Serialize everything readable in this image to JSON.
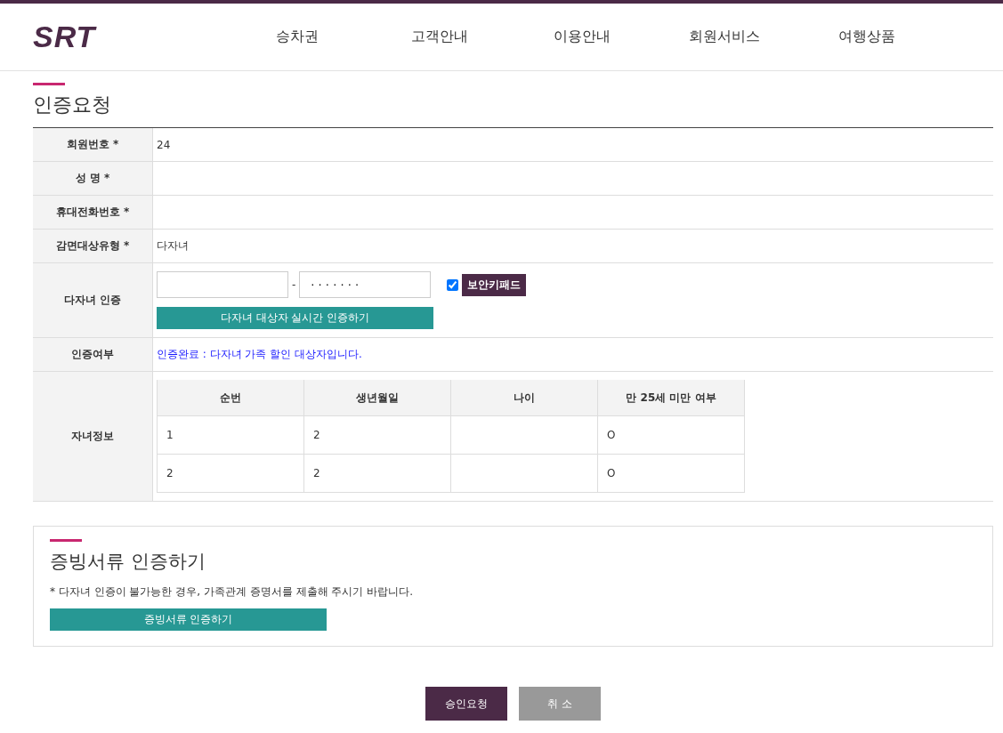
{
  "header": {
    "logo": "SRT",
    "nav": [
      "승차권",
      "고객안내",
      "이용안내",
      "회원서비스",
      "여행상품"
    ]
  },
  "title": "인증요청",
  "form": {
    "rows": [
      {
        "kind": "text",
        "label": "회원번호",
        "mark": "*",
        "value": "24"
      },
      {
        "kind": "text",
        "label": "성 명",
        "mark": "*"
      },
      {
        "kind": "text",
        "label": "휴대전화번호",
        "mark": "*"
      },
      {
        "kind": "text",
        "label": "감면대상유형",
        "mark": "*",
        "value": "다자녀"
      },
      {
        "kind": "verify",
        "label": "다자녀 인증",
        "separator": "-",
        "field_2": {
          "value": "· · · · · · ·"
        },
        "keypad": {
          "label": "보안키패드",
          "checked": true
        },
        "button": "다자녀 대상자 실시간 인증하기"
      },
      {
        "kind": "status",
        "label": "인증여부",
        "value": "인증완료 : 다자녀 가족 할인 대상자입니다."
      },
      {
        "kind": "children",
        "label": "자녀정보",
        "table": {
          "columns": [
            "순번",
            "생년월일",
            "나이",
            "만 25세 미만 여부"
          ],
          "rows": [
            [
              "1",
              "2",
              "",
              "O"
            ],
            [
              "2",
              "2",
              "",
              "O"
            ]
          ]
        }
      }
    ]
  },
  "documents": {
    "title": "증빙서류 인증하기",
    "note": "* 다자녀 인증이 불가능한 경우, 가족관계 증명서를 제출해 주시기 바랍니다.",
    "button": "증빙서류 인증하기"
  },
  "buttons": [
    {
      "kind": "primary",
      "label": "승인요청"
    },
    {
      "kind": "secondary",
      "label": "취 소"
    }
  ]
}
